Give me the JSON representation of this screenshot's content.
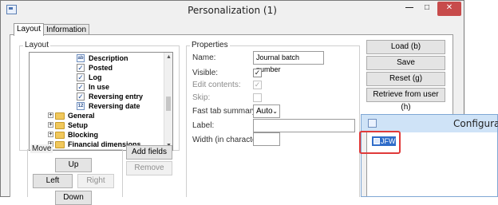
{
  "window": {
    "title": "Personalization (1)",
    "controls": {
      "minimize": "—",
      "maximize": "□",
      "close": "✕"
    }
  },
  "tabs": [
    {
      "label": "Layout",
      "active": true
    },
    {
      "label": "Information",
      "active": false
    }
  ],
  "layout": {
    "section_label": "Layout",
    "tree_items": [
      {
        "label": "Description",
        "icon": "text-field-icon"
      },
      {
        "label": "Posted",
        "icon": "checkbox-field-icon"
      },
      {
        "label": "Log",
        "icon": "checkbox-field-icon"
      },
      {
        "label": "In use",
        "icon": "checkbox-field-icon"
      },
      {
        "label": "Reversing entry",
        "icon": "checkbox-field-icon"
      },
      {
        "label": "Reversing date",
        "icon": "date-field-icon"
      },
      {
        "label": "General",
        "icon": "folder-icon"
      },
      {
        "label": "Setup",
        "icon": "folder-icon"
      },
      {
        "label": "Blocking",
        "icon": "folder-icon"
      },
      {
        "label": "Financial dimensions",
        "icon": "folder-icon"
      }
    ]
  },
  "move": {
    "section_label": "Move",
    "up": "Up",
    "left": "Left",
    "right": "Right",
    "down": "Down"
  },
  "field_buttons": {
    "add_fields": "Add fields",
    "remove": "Remove"
  },
  "properties": {
    "section_label": "Properties",
    "name_label": "Name:",
    "name_value": "Journal batch number",
    "visible_label": "Visible:",
    "visible_checked": true,
    "edit_contents_label": "Edit contents:",
    "edit_contents_checked": true,
    "skip_label": "Skip:",
    "skip_checked": false,
    "fast_tab_label": "Fast tab summary:",
    "fast_tab_value": "Auto",
    "label_label": "Label:",
    "label_value": "",
    "width_label": "Width (in characters):",
    "width_value": ""
  },
  "actions": {
    "load": "Load (b)",
    "save": "Save",
    "reset": "Reset (g)",
    "retrieve": "Retrieve from user (h)"
  },
  "config_window": {
    "title": "Configuration",
    "selected_item": "JFW",
    "highlight_color": "#e03a3a"
  }
}
